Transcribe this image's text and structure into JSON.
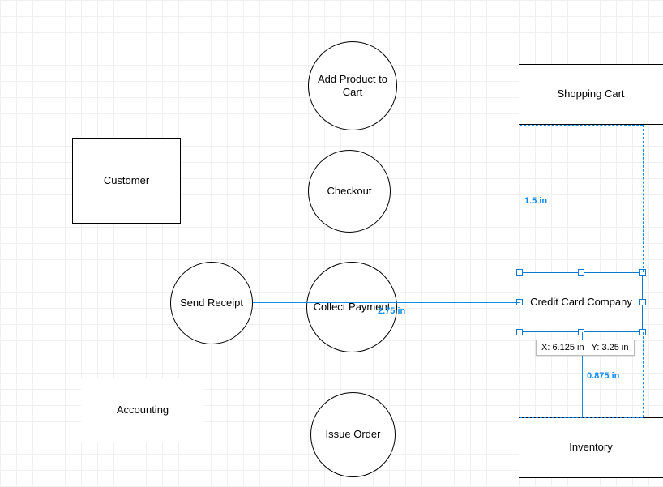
{
  "shapes": {
    "add_product": "Add Product to Cart",
    "checkout": "Checkout",
    "collect_payment": "Collect Payment",
    "issue_order": "Issue Order",
    "send_receipt": "Send Receipt",
    "customer": "Customer",
    "shopping_cart": "Shopping Cart",
    "credit_card_company": "Credit Card Company",
    "accounting": "Accounting",
    "inventory": "Inventory"
  },
  "measurements": {
    "top_gap": "1.5 in",
    "conn_length": "2.75 in",
    "bottom_gap": "0.875 in"
  },
  "tooltip": {
    "x_label": "X:",
    "x_value": "6.125 in",
    "y_label": "Y:",
    "y_value": "3.25 in"
  },
  "palette": {
    "guide": "#0d8af0",
    "selection": "#0b79d0"
  }
}
